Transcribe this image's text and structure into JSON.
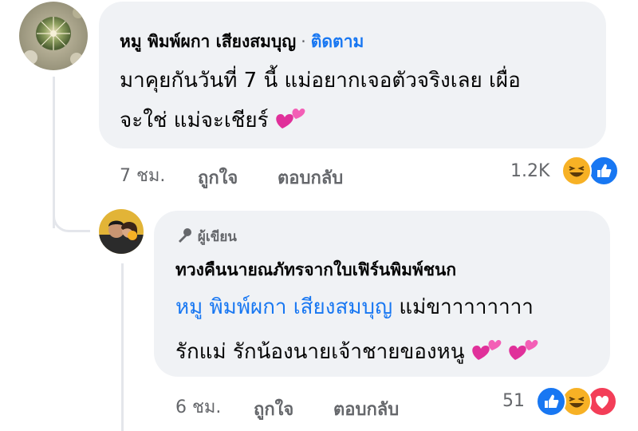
{
  "comment": {
    "author": "หมู พิมพ์ผกา เสียงสมบุญ",
    "separator": "·",
    "follow_label": "ติดตาม",
    "text_line1": "มาคุยกันวันที่ 7 นี้ แม่อยากเจอตัวจริงเลย เผื่อ",
    "text_line2": "จะใช่ แม่จะเชียร์",
    "time": "7 ชม.",
    "like_label": "ถูกใจ",
    "reply_label": "ตอบกลับ",
    "reaction_count": "1.2K",
    "reactions": [
      "haha-icon",
      "like-icon"
    ]
  },
  "reply": {
    "badge_label": "ผู้เขียน",
    "author": "ทวงคืนนายณภัทรจากใบเฟิร์นพิมพ์ชนก",
    "mention": "หมู พิมพ์ผกา เสียงสมบุญ",
    "text_line1_rest": "แม่ขาาาาาาาา",
    "text_line2": "รักแม่ รักน้องนายเจ้าชายของหนู",
    "time": "6 ชม.",
    "like_label": "ถูกใจ",
    "reply_label": "ตอบกลับ",
    "reaction_count": "51",
    "reactions": [
      "like-icon",
      "haha-icon",
      "love-icon"
    ]
  },
  "colors": {
    "accent": "#1877f2",
    "bubble": "#f0f2f5",
    "secondary_text": "#65676b",
    "love": "#f33e58",
    "haha": "#f7b125"
  }
}
